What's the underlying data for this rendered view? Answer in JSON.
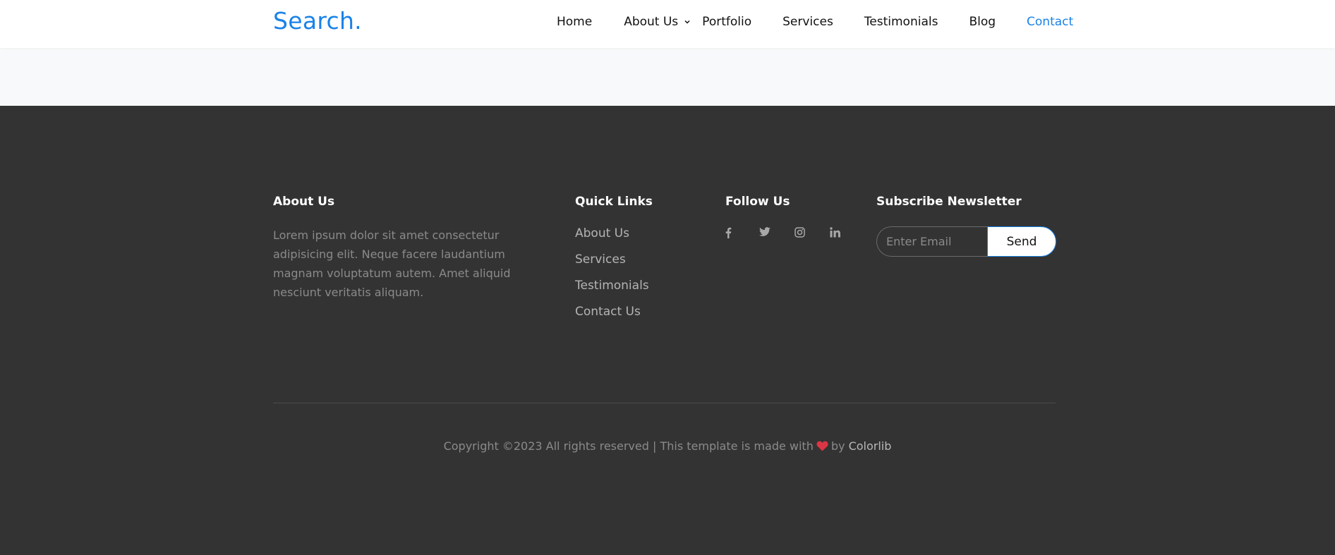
{
  "header": {
    "logo": "Search.",
    "nav": {
      "home": "Home",
      "about": "About Us",
      "portfolio": "Portfolio",
      "services": "Services",
      "testimonials": "Testimonials",
      "blog": "Blog",
      "contact": "Contact"
    }
  },
  "footer": {
    "about": {
      "title": "About Us",
      "text": "Lorem ipsum dolor sit amet consectetur adipisicing elit. Neque facere laudantium magnam voluptatum autem. Amet aliquid nesciunt veritatis aliquam."
    },
    "quick_links": {
      "title": "Quick Links",
      "items": [
        "About Us",
        "Services",
        "Testimonials",
        "Contact Us"
      ]
    },
    "follow": {
      "title": "Follow Us",
      "icons": [
        "facebook-icon",
        "twitter-icon",
        "instagram-icon",
        "linkedin-icon"
      ]
    },
    "newsletter": {
      "title": "Subscribe Newsletter",
      "placeholder": "Enter Email",
      "button": "Send"
    },
    "copyright": {
      "text": "Copyright ©2023 All rights reserved | This template is made with",
      "by": "by",
      "link": "Colorlib"
    }
  },
  "colors": {
    "accent": "#1a82e8",
    "footer_bg": "#333333",
    "hero_bg": "#f8f9fa",
    "heart": "#dc3545"
  }
}
